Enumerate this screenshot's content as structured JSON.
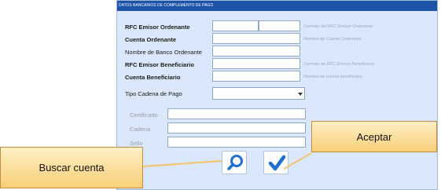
{
  "window": {
    "title": "DATOS BANCARIOS DE COMPLEMENTO DE PAGO"
  },
  "form": {
    "rfc_emisor_ordenante": {
      "label": "RFC Emisor Ordenante",
      "hint": "Formato del RFC Emisor Ordenante"
    },
    "cuenta_ordenante": {
      "label": "Cuenta Ordenante",
      "hint": "Nombre de Cuenta Ordenante"
    },
    "nombre_banco": {
      "label": "Nombre de Banco Ordenante"
    },
    "rfc_emisor_beneficiario": {
      "label": "RFC Emisor Beneficiario",
      "hint": "Formato de RFC Emisor Beneficiario"
    },
    "cuenta_beneficiario": {
      "label": "Cuenta Beneficiario",
      "hint": "Nombre de cuenta beneficiario"
    },
    "tipo_cadena": {
      "label": "Tipo Cadena de Pago",
      "value": ""
    },
    "certificado": {
      "label": "Certificado"
    },
    "cadena": {
      "label": "Cadena"
    },
    "sello": {
      "label": "Sello"
    }
  },
  "buttons": {
    "search_icon": "search-icon",
    "accept_icon": "checkmark-icon"
  },
  "callouts": {
    "buscar": "Buscar cuenta",
    "aceptar": "Aceptar"
  },
  "colors": {
    "titlebar": "#1d53a6",
    "window_bg": "#dbe8fb",
    "callout_fill": "#f8cf78",
    "icon_blue": "#1f6fd1"
  }
}
